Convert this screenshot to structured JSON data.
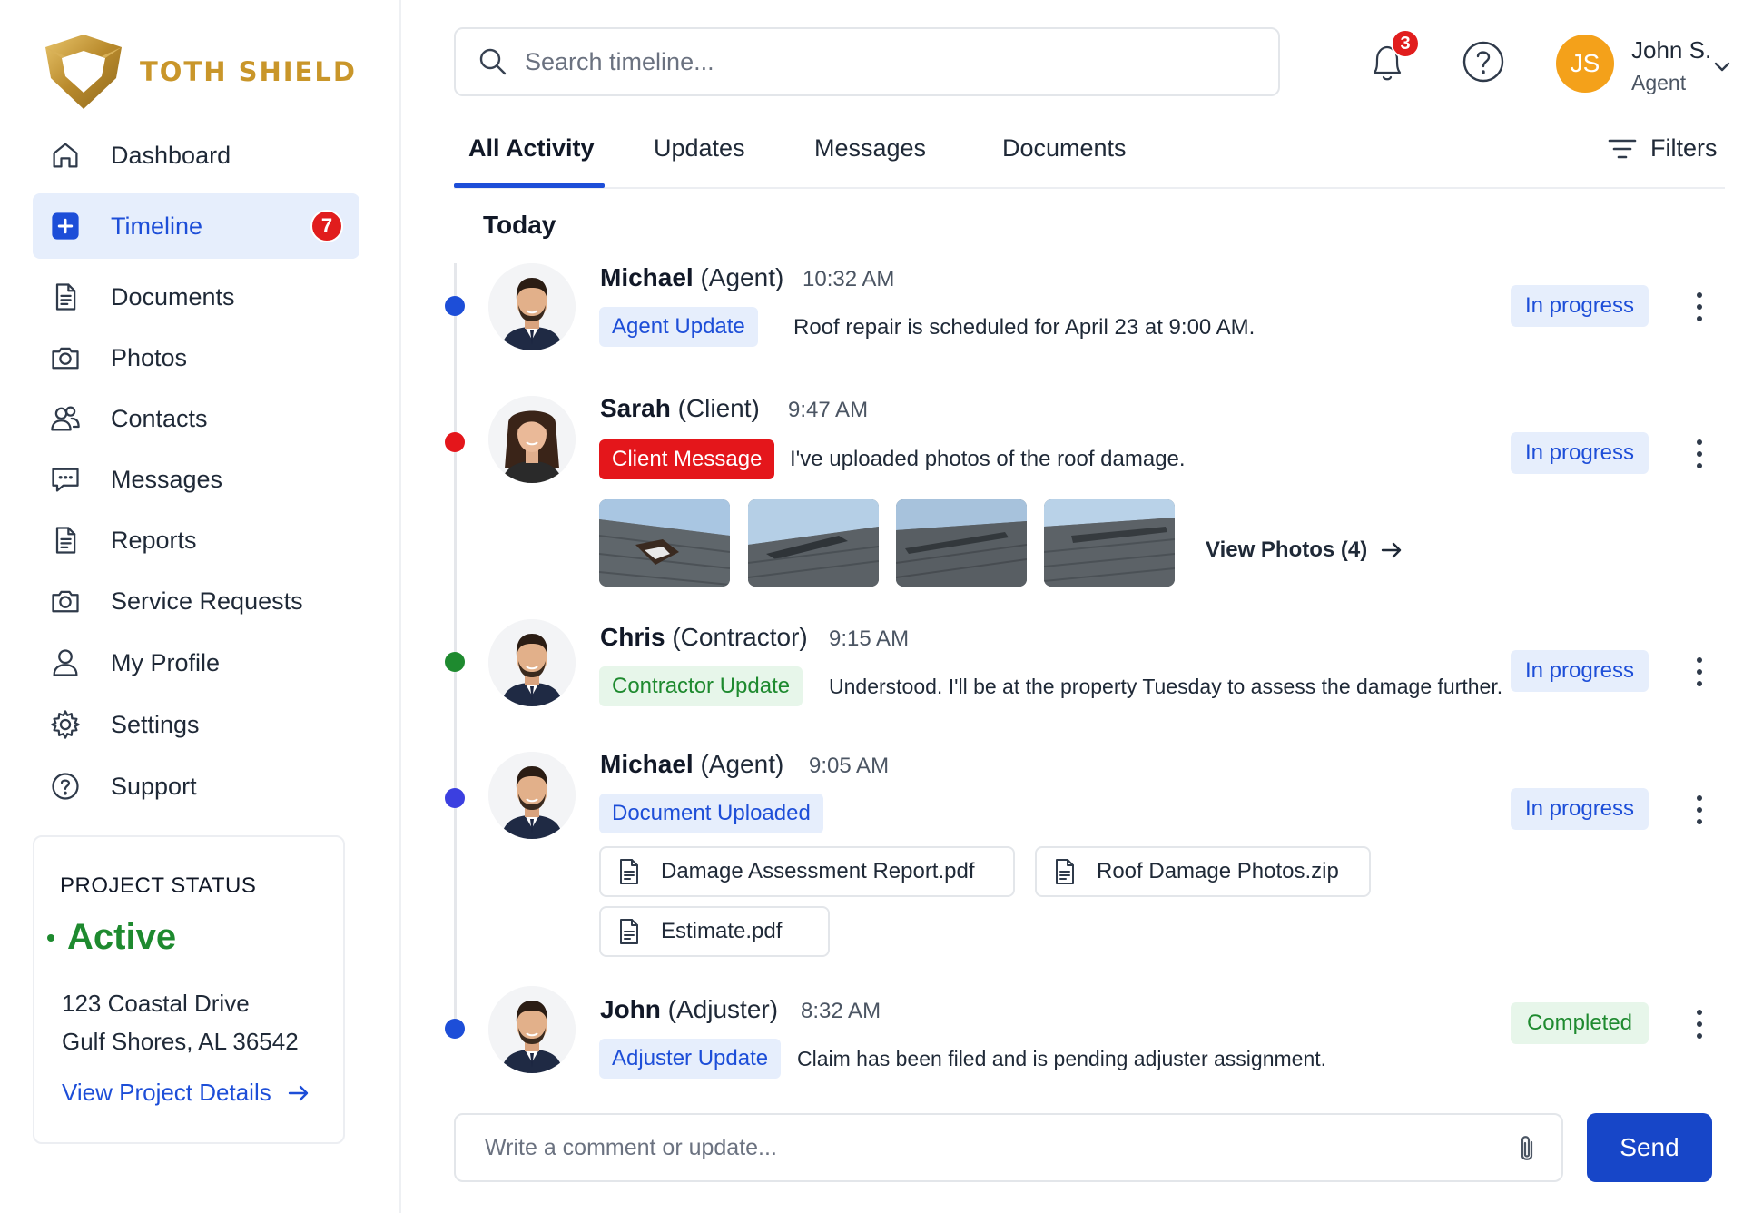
{
  "brand": {
    "name": "TOTH SHIELD",
    "accent": "#c9962a"
  },
  "sidebar": {
    "items": [
      {
        "label": "Dashboard",
        "icon": "home-icon"
      },
      {
        "label": "Timeline",
        "icon": "plus-square-icon",
        "active": true,
        "badge": "7"
      },
      {
        "label": "Documents",
        "icon": "document-icon"
      },
      {
        "label": "Photos",
        "icon": "camera-icon"
      },
      {
        "label": "Contacts",
        "icon": "users-icon"
      },
      {
        "label": "Messages",
        "icon": "chat-icon"
      },
      {
        "label": "Reports",
        "icon": "report-icon"
      },
      {
        "label": "Service Requests",
        "icon": "camera-icon"
      },
      {
        "label": "My Profile",
        "icon": "user-icon"
      },
      {
        "label": "Settings",
        "icon": "gear-icon"
      },
      {
        "label": "Support",
        "icon": "help-circle-icon"
      }
    ],
    "project_status": {
      "title": "PROJECT STATUS",
      "value": "Active",
      "address_line1": "123 Coastal Drive",
      "address_line2": "Gulf Shores, AL 36542",
      "link": "View Project Details"
    }
  },
  "header": {
    "search_placeholder": "Search timeline...",
    "notifications_count": "3",
    "user": {
      "initials": "JS",
      "name": "John S.",
      "role": "Agent"
    }
  },
  "tabs": [
    "All Activity",
    "Updates",
    "Messages",
    "Documents"
  ],
  "filters_label": "Filters",
  "section_label": "Today",
  "colors": {
    "primary": "#1d4ed8",
    "danger": "#e4161b",
    "success": "#1e8a2f"
  },
  "entries": [
    {
      "name": "Michael",
      "role": "(Agent)",
      "time": "10:32 AM",
      "tag": "Agent Update",
      "message": "Roof repair is scheduled for April 23 at 9:00 AM.",
      "status": "In progress",
      "dot_color": "#1d4ed8"
    },
    {
      "name": "Sarah",
      "role": "(Client)",
      "time": "9:47 AM",
      "tag": "Client Message",
      "message": "I've uploaded photos of the roof damage.",
      "status": "In progress",
      "dot_color": "#e4161b",
      "view_photos": "View Photos (4)"
    },
    {
      "name": "Chris",
      "role": "(Contractor)",
      "time": "9:15 AM",
      "tag": "Contractor Update",
      "message": "Understood. I'll be at the property Tuesday to assess the damage further.",
      "status": "In progress",
      "dot_color": "#1e8a2f"
    },
    {
      "name": "Michael",
      "role": "(Agent)",
      "time": "9:05 AM",
      "tag": "Document Uploaded",
      "status": "In progress",
      "dot_color": "#3b3fe0",
      "files": [
        "Damage Assessment Report.pdf",
        "Roof Damage Photos.zip",
        "Estimate.pdf"
      ]
    },
    {
      "name": "John",
      "role": "(Adjuster)",
      "time": "8:32 AM",
      "tag": "Adjuster Update",
      "message": "Claim has been filed and is pending adjuster assignment.",
      "status": "Completed",
      "dot_color": "#1d4ed8"
    }
  ],
  "composer": {
    "placeholder": "Write a comment or update...",
    "send_label": "Send"
  }
}
